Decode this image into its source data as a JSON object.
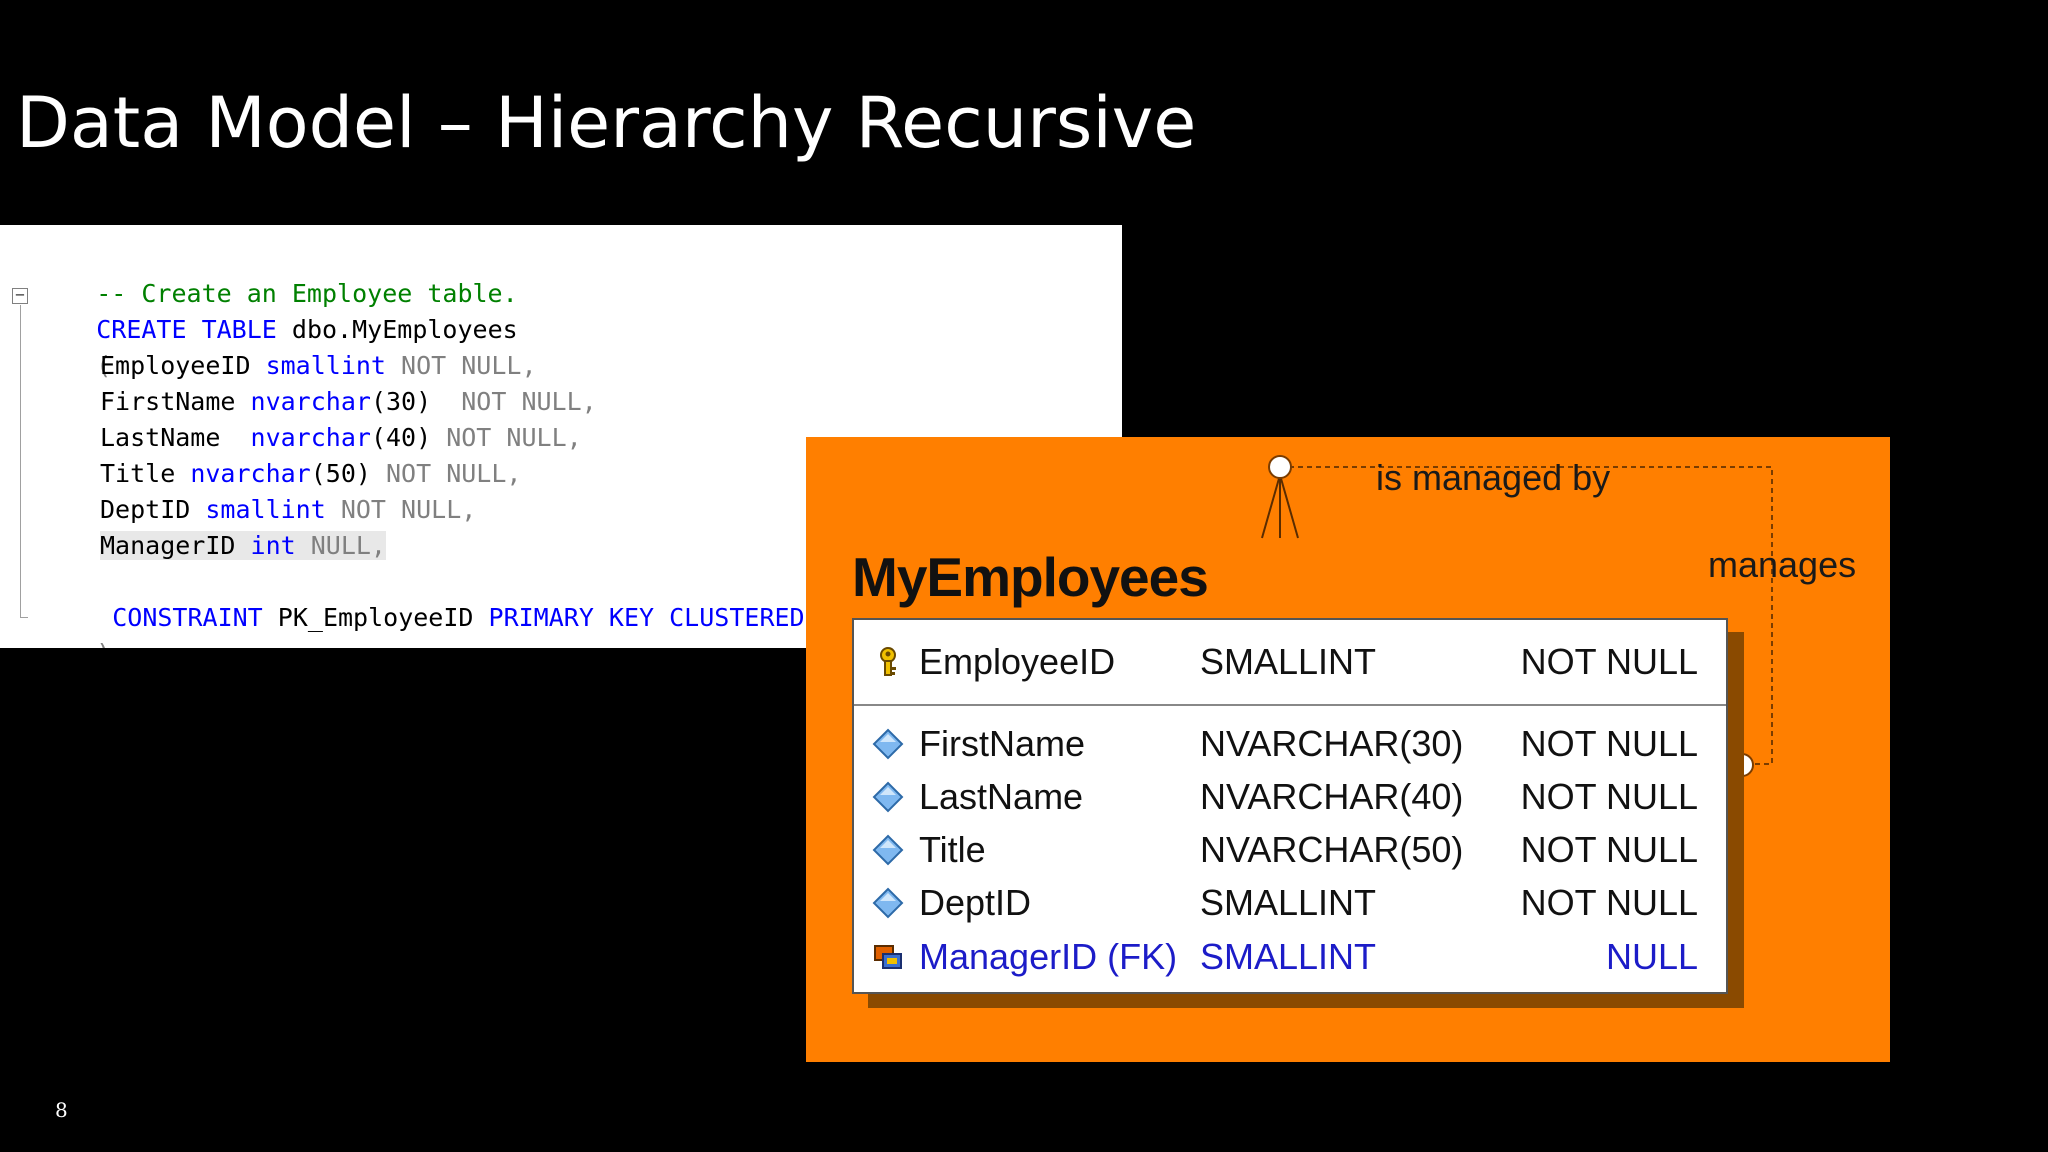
{
  "slide": {
    "title": "Data Model – Hierarchy Recursive",
    "page_number": "8"
  },
  "code": {
    "comment": "-- Create an Employee table.",
    "create_kw": "CREATE TABLE",
    "table_name": "dbo.MyEmployees",
    "open_paren": "(",
    "columns": [
      {
        "name": "EmployeeID ",
        "type": "smallint",
        "args": "",
        "null": " NOT NULL,"
      },
      {
        "name": "FirstName ",
        "type": "nvarchar",
        "args": "(30) ",
        "null": " NOT NULL,"
      },
      {
        "name": "LastName  ",
        "type": "nvarchar",
        "args": "(40)",
        "null": " NOT NULL,"
      },
      {
        "name": "Title ",
        "type": "nvarchar",
        "args": "(50)",
        "null": " NOT NULL,"
      },
      {
        "name": "DeptID ",
        "type": "smallint",
        "args": "",
        "null": " NOT NULL,"
      },
      {
        "name": "ManagerID ",
        "type": "int",
        "args": "",
        "null": " NULL,"
      }
    ],
    "constraint_kw": "CONSTRAINT",
    "constraint_name": " PK_EmployeeID ",
    "pk_kw": "PRIMARY KEY CLUSTERED",
    "close": ");"
  },
  "erd": {
    "entity_name": "MyEmployees",
    "rel_label_top": "is managed by",
    "rel_label_side": "manages",
    "pk_attribute": {
      "name": "EmployeeID",
      "type": "SMALLINT",
      "null": "NOT NULL",
      "icon": "key-icon"
    },
    "attributes": [
      {
        "name": "FirstName",
        "type": "NVARCHAR(30)",
        "null": "NOT NULL",
        "icon": "diamond-icon"
      },
      {
        "name": "LastName",
        "type": "NVARCHAR(40)",
        "null": "NOT NULL",
        "icon": "diamond-icon"
      },
      {
        "name": "Title",
        "type": "NVARCHAR(50)",
        "null": "NOT NULL",
        "icon": "diamond-icon"
      },
      {
        "name": "DeptID",
        "type": "SMALLINT",
        "null": "NOT NULL",
        "icon": "diamond-icon"
      },
      {
        "name": "ManagerID (FK)",
        "type": "SMALLINT",
        "null": "NULL",
        "icon": "foreign-key-icon"
      }
    ],
    "colors": {
      "panel": "#ff7f00",
      "fk_text": "#1c1cc8"
    }
  }
}
